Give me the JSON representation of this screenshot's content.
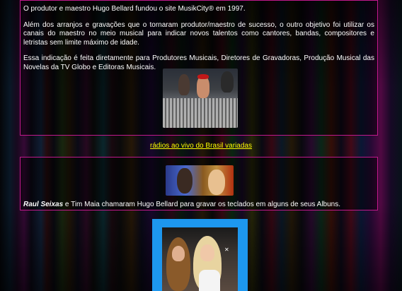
{
  "intro": {
    "paragraph1": "O produtor e maestro Hugo Bellard fundou o site MusikCity® em 1997.",
    "paragraph2": "Além dos arranjos e gravações que o tornaram produtor/maestro de sucesso, o outro objetivo foi utilizar os canais do maestro no meio musical para indicar novos talentos como cantores, bandas, compositores e letristas sem limite máximo de idade.",
    "paragraph3": "Essa indicação é feita diretamente para Produtores Musicais, Diretores de Gravadoras, Produção Musical das Novelas da TV Globo e Editoras Musicais."
  },
  "link": {
    "radios_label": "rádios ao vivo do Brasil variadas"
  },
  "raul": {
    "name": "Raul Seixas",
    "caption_rest": " e Tim Maia chamaram Hugo Bellard para gravar os teclados em alguns de seus Albuns."
  },
  "photo3": {
    "close_glyph": "✕"
  },
  "colors": {
    "panel_border": "#c0198c",
    "link": "#ffff00",
    "frame_blue": "#1d97ef",
    "text": "#ffffff"
  }
}
